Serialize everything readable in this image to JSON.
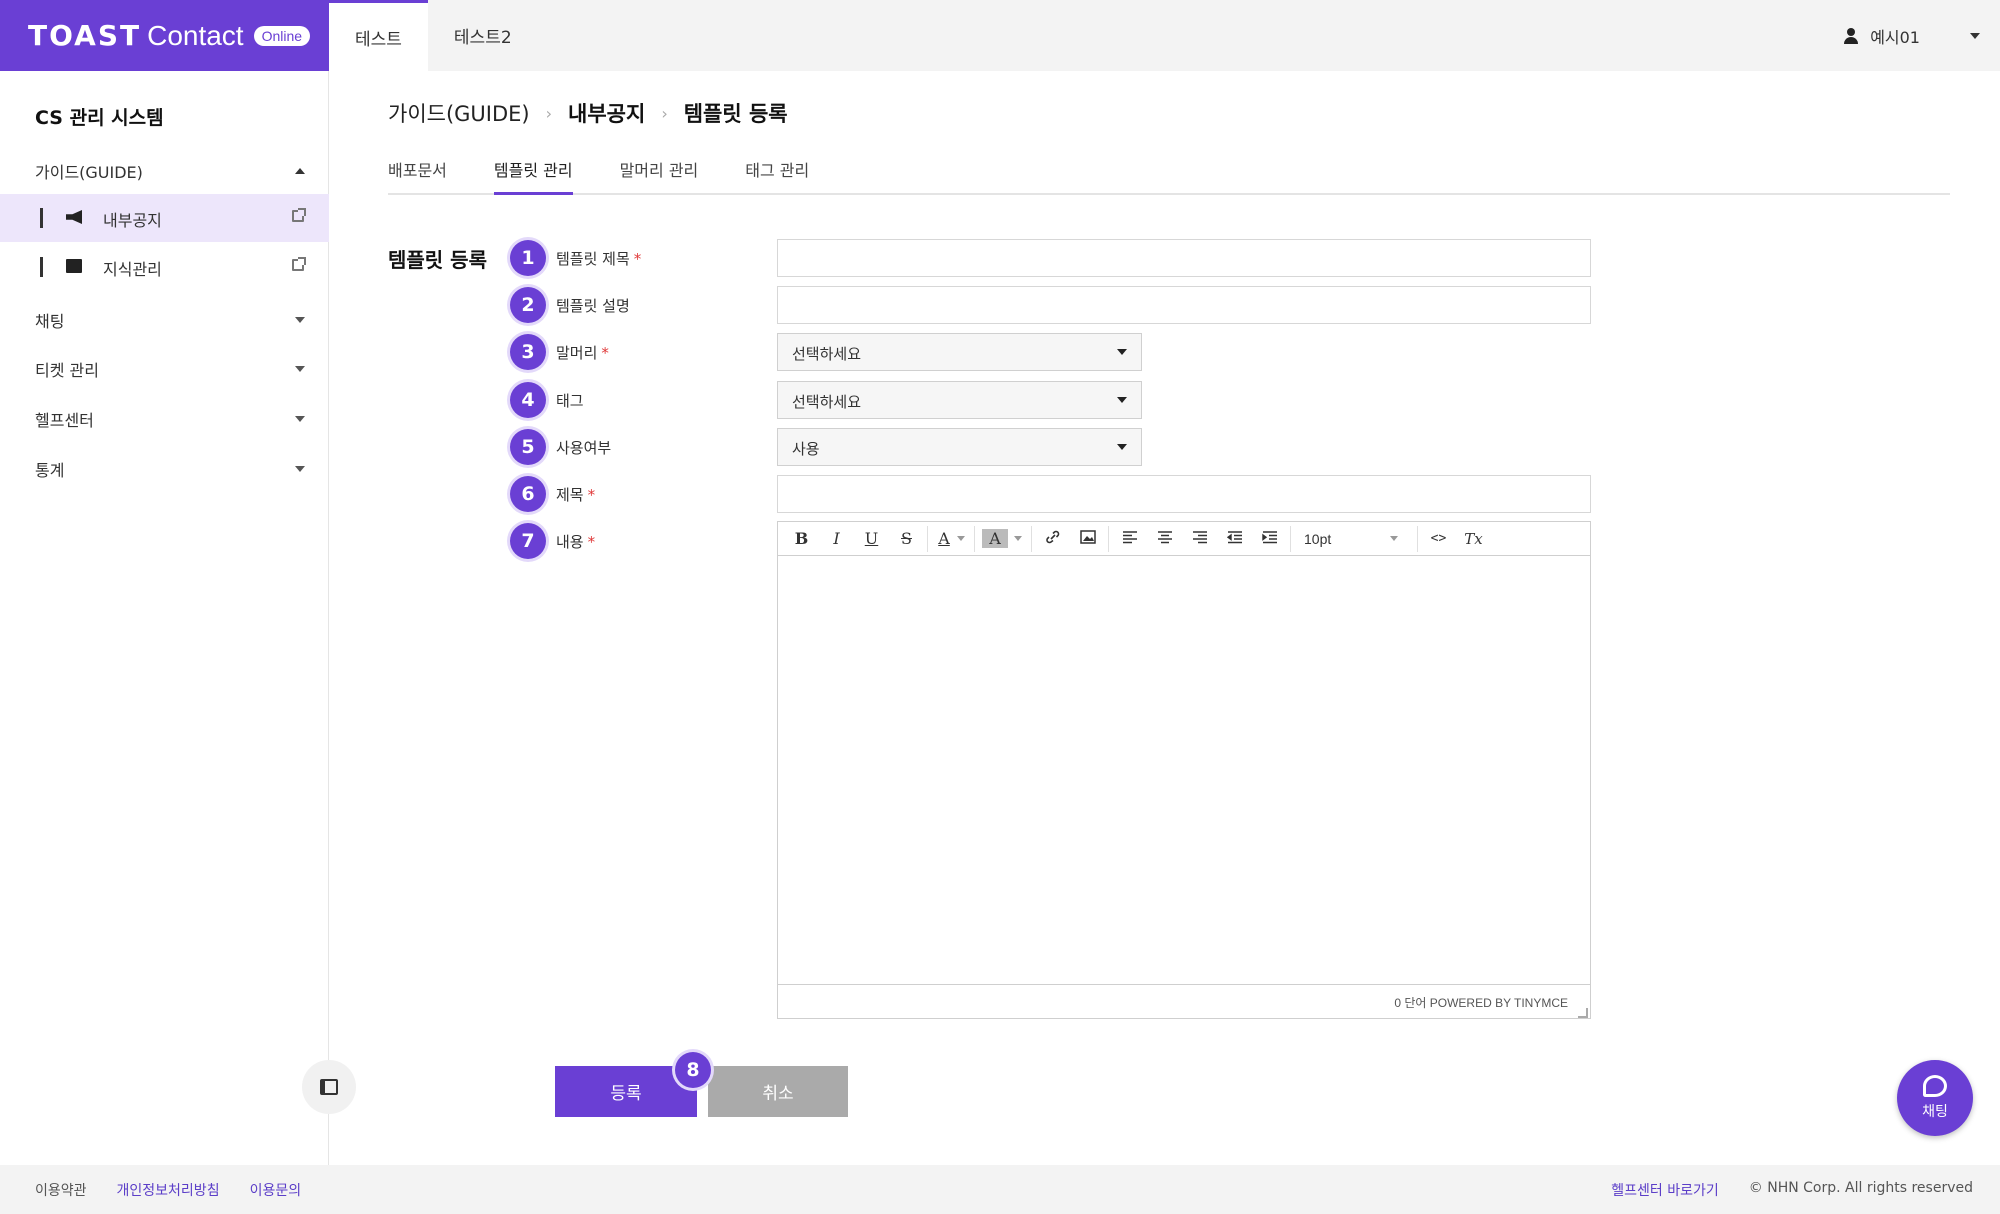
{
  "brand": {
    "logo_text": "TOAST",
    "product": "Contact",
    "badge": "Online"
  },
  "top_tabs": [
    {
      "label": "테스트",
      "active": true
    },
    {
      "label": "테스트2",
      "active": false
    }
  ],
  "user": {
    "name": "예시01"
  },
  "sidebar": {
    "title": "CS 관리 시스템",
    "groups": [
      {
        "label": "가이드(GUIDE)",
        "expanded": true
      },
      {
        "label": "채팅"
      },
      {
        "label": "티켓 관리"
      },
      {
        "label": "헬프센터"
      },
      {
        "label": "통계"
      }
    ],
    "items": [
      {
        "label": "내부공지",
        "icon": "megaphone-icon",
        "active": true
      },
      {
        "label": "지식관리",
        "icon": "book-icon"
      }
    ]
  },
  "breadcrumb": {
    "items": [
      "가이드(GUIDE)",
      "내부공지",
      "템플릿 등록"
    ],
    "separator": "›"
  },
  "sub_tabs": [
    {
      "label": "배포문서"
    },
    {
      "label": "템플릿 관리",
      "active": true
    },
    {
      "label": "말머리 관리"
    },
    {
      "label": "태그 관리"
    }
  ],
  "form": {
    "section_title": "템플릿 등록",
    "required_mark": "*",
    "fields": [
      {
        "num": "1",
        "label": "템플릿 제목",
        "required": true,
        "type": "text",
        "value": ""
      },
      {
        "num": "2",
        "label": "템플릿 설명",
        "required": false,
        "type": "text",
        "value": ""
      },
      {
        "num": "3",
        "label": "말머리",
        "required": true,
        "type": "select",
        "value": "선택하세요"
      },
      {
        "num": "4",
        "label": "태그",
        "required": false,
        "type": "select",
        "value": "선택하세요"
      },
      {
        "num": "5",
        "label": "사용여부",
        "required": false,
        "type": "select",
        "value": "사용"
      },
      {
        "num": "6",
        "label": "제목",
        "required": true,
        "type": "text",
        "value": ""
      },
      {
        "num": "7",
        "label": "내용",
        "required": true,
        "type": "editor"
      }
    ]
  },
  "editor": {
    "toolbar": {
      "bold": "B",
      "italic": "I",
      "underline": "U",
      "strike": "S",
      "text_color": "A",
      "bg_color": "A",
      "font_size": "10pt",
      "code": "<>",
      "clear_format": "Tx"
    },
    "status": "0 단어 POWERED BY TINYMCE"
  },
  "actions": {
    "submit_label": "등록",
    "cancel_label": "취소",
    "submit_num": "8"
  },
  "chat_fab": {
    "label": "채팅"
  },
  "footer": {
    "left": [
      "이용약관",
      "개인정보처리방침",
      "이용문의"
    ],
    "help_link": "헬프센터 바로가기",
    "copyright": "© NHN Corp. All rights reserved"
  },
  "colors": {
    "accent": "#6a3fd4",
    "required": "#e03a3a",
    "cancel": "#aaaaaa"
  }
}
